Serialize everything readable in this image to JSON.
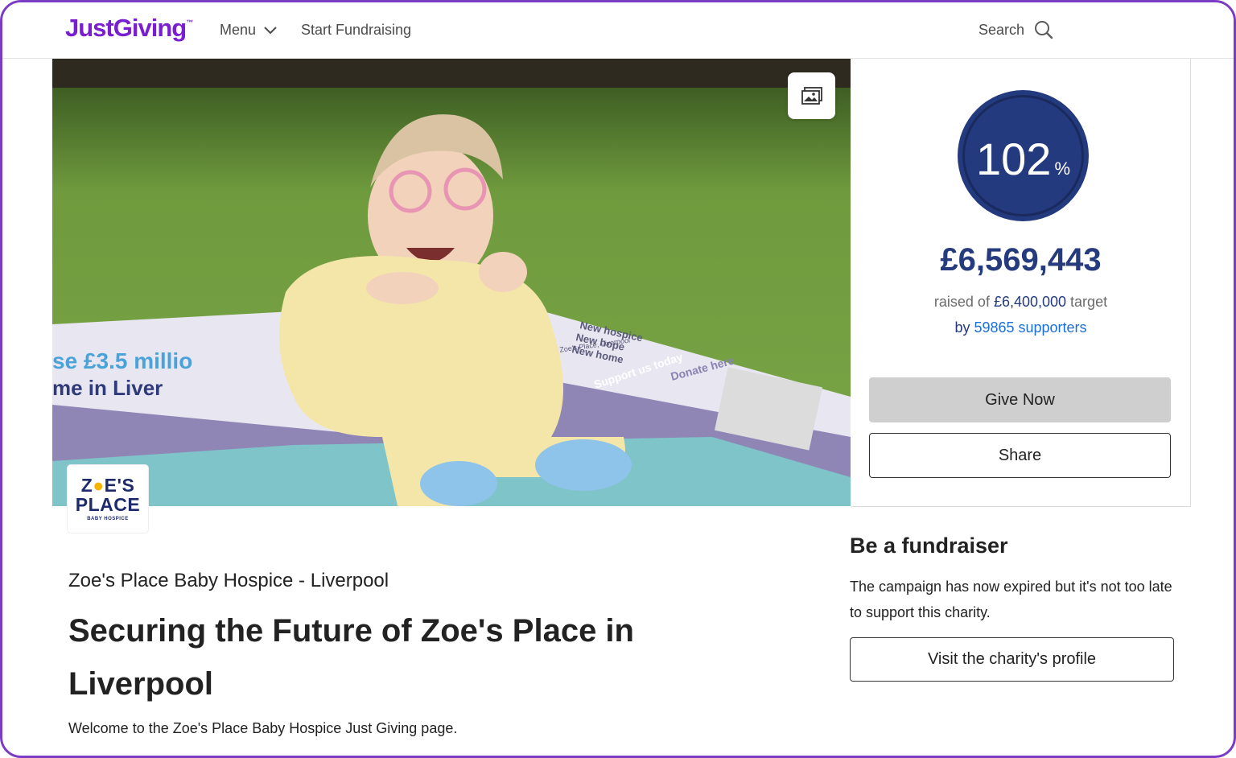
{
  "header": {
    "logo_text": "JustGiving",
    "logo_mark": "™",
    "menu_label": "Menu",
    "start_label": "Start Fundraising",
    "search_label": "Search"
  },
  "hero": {
    "banner_texts": [
      "New hospice",
      "New hope",
      "New home",
      "For Zoe's Place, Liverpool",
      "Support us today",
      "Donate here",
      "se £3.5 millio",
      "me in Liver"
    ]
  },
  "charity_logo": {
    "line1a": "Z",
    "line1b": "E'S",
    "line2": "PLACE",
    "line3": "BABY HOSPICE"
  },
  "progress": {
    "percent": "102",
    "percent_sign": "%",
    "amount": "£6,569,443",
    "raised_prefix": "raised of ",
    "target": "£6,400,000",
    "target_suffix": " target",
    "by_prefix": "by ",
    "supporters": "59865 supporters"
  },
  "actions": {
    "give_now": "Give Now",
    "share": "Share"
  },
  "page": {
    "charity_name": "Zoe's Place Baby Hospice - Liverpool",
    "title": "Securing the Future of Zoe's Place in Liverpool",
    "welcome": "Welcome to the Zoe's Place Baby Hospice Just Giving page."
  },
  "fundraiser": {
    "heading": "Be a fundraiser",
    "text": "The campaign has now expired but it's not too late to support this charity.",
    "visit_label": "Visit the charity's profile"
  },
  "colors": {
    "brand": "#7a1fd0",
    "ring": "#243a7e",
    "link": "#1b6fd8",
    "give_button": "#cfcfcf"
  }
}
